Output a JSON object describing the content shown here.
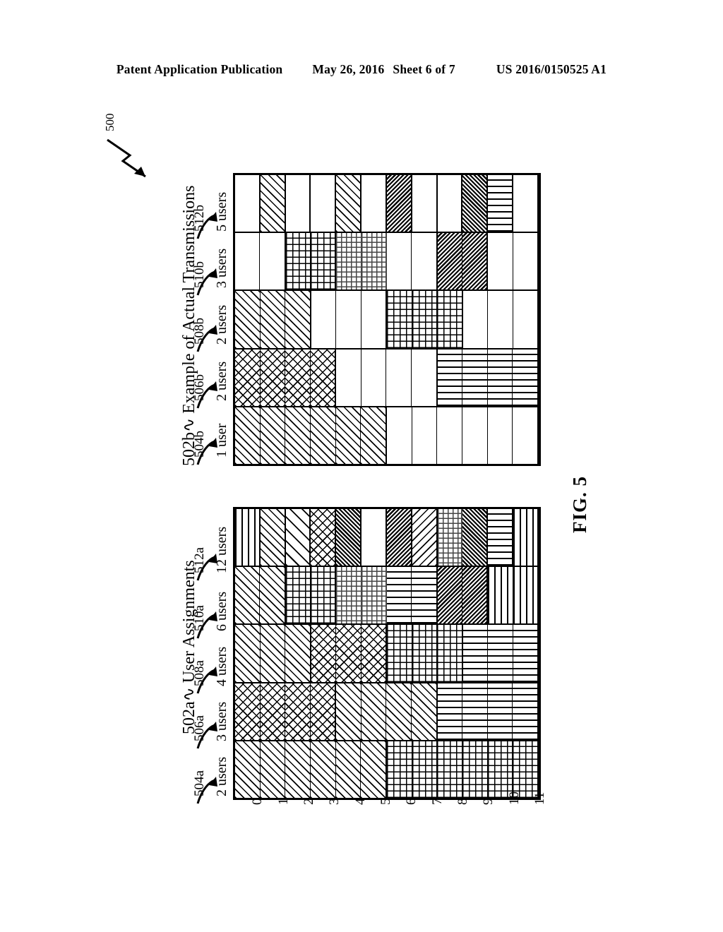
{
  "header": {
    "publication": "Patent Application Publication",
    "date": "May 26, 2016",
    "sheet": "Sheet 6 of 7",
    "docnum": "US 2016/0150525 A1"
  },
  "figure": {
    "label": "FIG. 5",
    "ref": "500"
  },
  "panels": [
    {
      "id": "user-assignments",
      "ref": "502a",
      "title": "Example of Actual Transmissions",
      "groups": []
    }
  ],
  "left_panel": {
    "ref": "502a",
    "title": "User Assignments",
    "groups": [
      {
        "ref": "504a",
        "caption": "2 users"
      },
      {
        "ref": "506a",
        "caption": "3 users"
      },
      {
        "ref": "508a",
        "caption": "4 users"
      },
      {
        "ref": "510a",
        "caption": "6 users"
      },
      {
        "ref": "512a",
        "caption": "12 users"
      }
    ]
  },
  "right_panel": {
    "ref": "502b",
    "title": "Example of Actual Transmissions",
    "groups": [
      {
        "ref": "504b",
        "caption": "1 user"
      },
      {
        "ref": "506b",
        "caption": "2 users"
      },
      {
        "ref": "508b",
        "caption": "2 users"
      },
      {
        "ref": "510b",
        "caption": "3 users"
      },
      {
        "ref": "512b",
        "caption": "5 users"
      }
    ]
  },
  "index_labels": [
    "0",
    "1",
    "2",
    "3",
    "4",
    "5",
    "6",
    "7",
    "8",
    "9",
    "10",
    "11"
  ],
  "chart_data": {
    "type": "heatmap",
    "title": "FIG. 5",
    "xlabel": "",
    "ylabel": "",
    "index_labels": [
      "0",
      "1",
      "2",
      "3",
      "4",
      "5",
      "6",
      "7",
      "8",
      "9",
      "10",
      "11"
    ],
    "pattern_legend": {
      "p-blank": "no transmission / empty",
      "p-diag": "diagonal hatch",
      "p-diag-coarse": "coarse diagonal hatch",
      "p-diag-dense": "dense diagonal hatch",
      "p-bdiag": "back diagonal hatch",
      "p-bdiag-dense": "dense back diagonal hatch",
      "p-cross": "crosshatch",
      "p-grid": "orthogonal grid",
      "p-horiz": "horizontal lines",
      "p-vert": "vertical lines",
      "p-dots": "dotted"
    },
    "panels": [
      {
        "name": "User Assignments",
        "ref": "502a",
        "rows": [
          {
            "ref": "504a",
            "caption": "2 users",
            "cells": [
              "p-diag",
              "p-diag",
              "p-diag",
              "p-diag",
              "p-diag",
              "p-diag",
              "p-grid",
              "p-grid",
              "p-grid",
              "p-grid",
              "p-grid",
              "p-grid"
            ],
            "blocks": [
              6,
              6
            ]
          },
          {
            "ref": "506a",
            "caption": "3 users",
            "cells": [
              "p-cross",
              "p-cross",
              "p-cross",
              "p-cross",
              "p-diag",
              "p-diag",
              "p-diag",
              "p-diag",
              "p-horiz",
              "p-horiz",
              "p-horiz",
              "p-horiz"
            ],
            "blocks": [
              4,
              4,
              4
            ]
          },
          {
            "ref": "508a",
            "caption": "4 users",
            "cells": [
              "p-diag",
              "p-diag",
              "p-diag",
              "p-cross",
              "p-cross",
              "p-cross",
              "p-grid",
              "p-grid",
              "p-grid",
              "p-horiz",
              "p-horiz",
              "p-horiz"
            ],
            "blocks": [
              3,
              3,
              3,
              3
            ]
          },
          {
            "ref": "510a",
            "caption": "6 users",
            "cells": [
              "p-diag",
              "p-diag",
              "p-grid",
              "p-grid",
              "p-dots",
              "p-dots",
              "p-horiz",
              "p-horiz",
              "p-bdiag-dense",
              "p-bdiag-dense",
              "p-vert",
              "p-vert"
            ],
            "blocks": [
              2,
              2,
              2,
              2,
              2,
              2
            ]
          },
          {
            "ref": "512a",
            "caption": "12 users",
            "cells": [
              "p-vert",
              "p-diag",
              "p-diag-coarse",
              "p-cross",
              "p-diag-dense",
              "p-blank",
              "p-bdiag-dense",
              "p-bdiag",
              "p-dots",
              "p-diag-dense",
              "p-horiz",
              "p-vert"
            ],
            "blocks": [
              1,
              1,
              1,
              1,
              1,
              1,
              1,
              1,
              1,
              1,
              1,
              1
            ]
          }
        ]
      },
      {
        "name": "Example of Actual Transmissions",
        "ref": "502b",
        "rows": [
          {
            "ref": "504b",
            "caption": "1 user",
            "cells": [
              "p-diag",
              "p-diag",
              "p-diag",
              "p-diag",
              "p-diag",
              "p-diag",
              "p-blank",
              "p-blank",
              "p-blank",
              "p-blank",
              "p-blank",
              "p-blank"
            ],
            "blocks": [
              6,
              6
            ]
          },
          {
            "ref": "506b",
            "caption": "2 users",
            "cells": [
              "p-cross",
              "p-cross",
              "p-cross",
              "p-cross",
              "p-blank",
              "p-blank",
              "p-blank",
              "p-blank",
              "p-horiz",
              "p-horiz",
              "p-horiz",
              "p-horiz"
            ],
            "blocks": [
              4,
              4,
              4
            ]
          },
          {
            "ref": "508b",
            "caption": "2 users",
            "cells": [
              "p-diag",
              "p-diag",
              "p-diag",
              "p-blank",
              "p-blank",
              "p-blank",
              "p-grid",
              "p-grid",
              "p-grid",
              "p-blank",
              "p-blank",
              "p-blank"
            ],
            "blocks": [
              3,
              3,
              3,
              3
            ]
          },
          {
            "ref": "510b",
            "caption": "3 users",
            "cells": [
              "p-blank",
              "p-blank",
              "p-grid",
              "p-grid",
              "p-dots",
              "p-dots",
              "p-blank",
              "p-blank",
              "p-bdiag-dense",
              "p-bdiag-dense",
              "p-blank",
              "p-blank"
            ],
            "blocks": [
              2,
              2,
              2,
              2,
              2,
              2
            ]
          },
          {
            "ref": "512b",
            "caption": "5 users",
            "cells": [
              "p-blank",
              "p-diag",
              "p-blank",
              "p-blank",
              "p-diag",
              "p-blank",
              "p-bdiag-dense",
              "p-blank",
              "p-blank",
              "p-diag-dense",
              "p-horiz",
              "p-blank"
            ],
            "blocks": [
              1,
              1,
              1,
              1,
              1,
              1,
              1,
              1,
              1,
              1,
              1,
              1
            ]
          }
        ]
      }
    ]
  }
}
